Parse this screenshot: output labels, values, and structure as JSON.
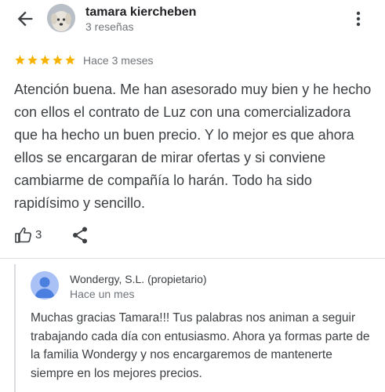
{
  "header": {
    "reviewer_name": "tamara kiercheben",
    "reviewer_meta": "3 reseñas",
    "back_icon": "arrow-left-icon",
    "menu_icon": "more-vert-icon"
  },
  "review": {
    "rating": 5,
    "rating_max": 5,
    "star_color": "#f6b400",
    "time": "Hace 3 meses",
    "text": "Atención buena. Me han asesorado muy bien y he hecho con ellos el contrato de Luz con una comercializadora que ha hecho un buen precio. Y lo mejor es que ahora ellos se encargaran de mirar ofertas y si conviene cambiarme de compañía lo harán. Todo ha sido rapidísimo y sencillo.",
    "likes": "3"
  },
  "owner_response": {
    "name": "Wondergy, S.L. (propietario)",
    "time": "Hace un mes",
    "avatar_color": "#a9c1f5",
    "text": "Muchas gracias Tamara!!! Tus palabras nos animan a seguir trabajando cada día con entusiasmo. Ahora ya formas parte de la familia Wondergy y nos encargaremos de mantenerte siempre en los mejores precios."
  }
}
